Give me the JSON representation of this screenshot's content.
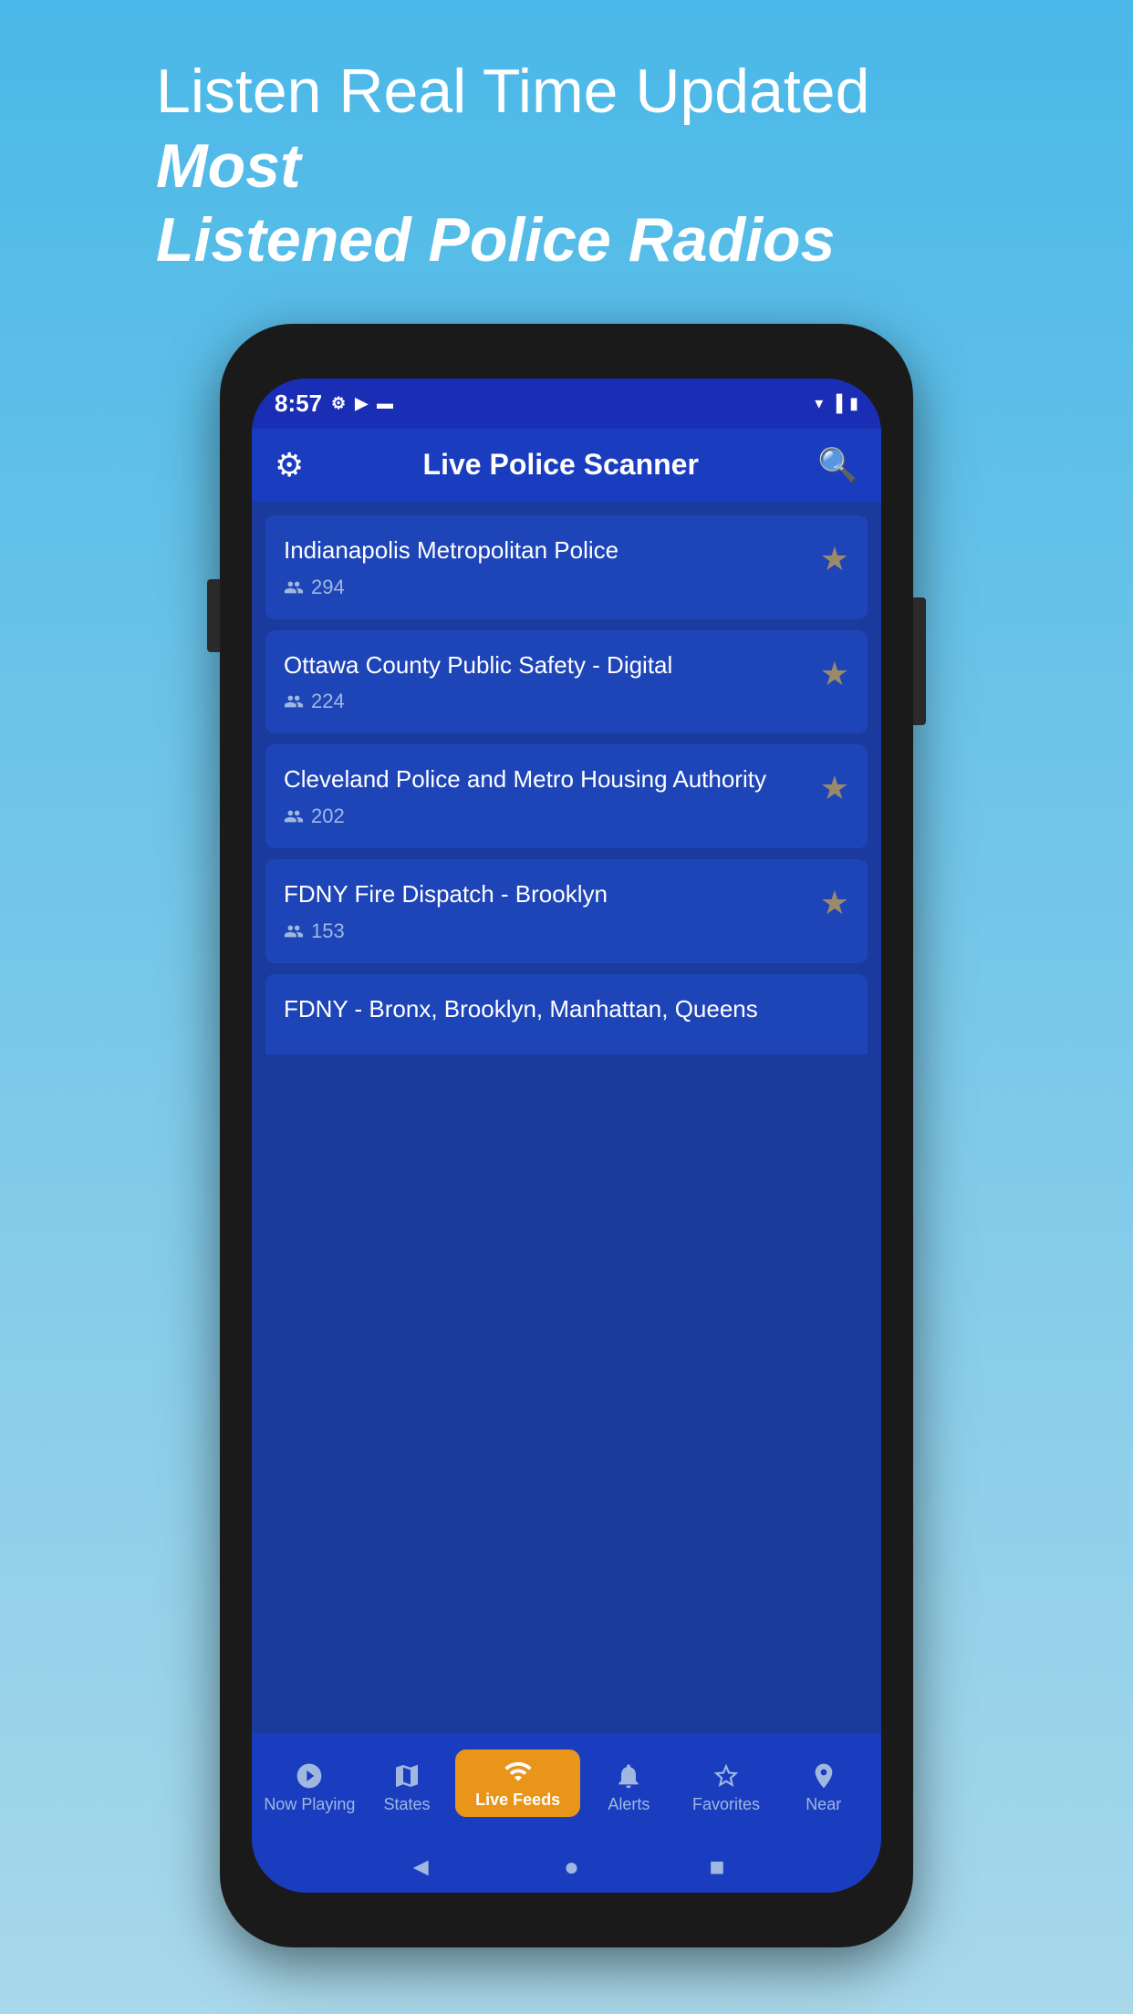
{
  "header": {
    "line1": "Listen Real Time Updated ",
    "line1_bold": "Most",
    "line2": "Listened Police Radios"
  },
  "status_bar": {
    "time": "8:57",
    "icons": [
      "⚙",
      "▶",
      "🔒"
    ],
    "right_icons": [
      "wifi",
      "signal",
      "battery"
    ]
  },
  "app_bar": {
    "title": "Live Police Scanner",
    "settings_icon": "⚙",
    "search_icon": "🔍"
  },
  "feed_items": [
    {
      "title": "Indianapolis Metropolitan Police",
      "listeners": "294",
      "favorited": false
    },
    {
      "title": "Ottawa County Public Safety - Digital",
      "listeners": "224",
      "favorited": false
    },
    {
      "title": "Cleveland Police and Metro Housing Authority",
      "listeners": "202",
      "favorited": false
    },
    {
      "title": "FDNY Fire Dispatch - Brooklyn",
      "listeners": "153",
      "favorited": false
    },
    {
      "title": "FDNY - Bronx, Brooklyn, Manhattan, Queens",
      "listeners": "",
      "favorited": false,
      "partial": true
    }
  ],
  "bottom_nav": {
    "items": [
      {
        "label": "Now Playing",
        "icon": "▶",
        "active": false
      },
      {
        "label": "States",
        "icon": "🗺",
        "active": false
      },
      {
        "label": "Live Feeds",
        "icon": "📡",
        "active": true
      },
      {
        "label": "Alerts",
        "icon": "🚨",
        "active": false
      },
      {
        "label": "Favorites",
        "icon": "☆",
        "active": false
      },
      {
        "label": "Near",
        "icon": "📍",
        "active": false
      }
    ]
  },
  "system_bar": {
    "back": "◄",
    "home": "●",
    "recent": "■"
  },
  "colors": {
    "background_top": "#4ab8e8",
    "background_bottom": "#a8d8ea",
    "app_bar": "#1a3cbf",
    "content_bg": "#1a3a9e",
    "card_bg": "#1e45b8",
    "active_tab": "#e8951a",
    "star": "#9a8a6a",
    "text_white": "#ffffff",
    "text_muted": "#a0b8e0"
  }
}
